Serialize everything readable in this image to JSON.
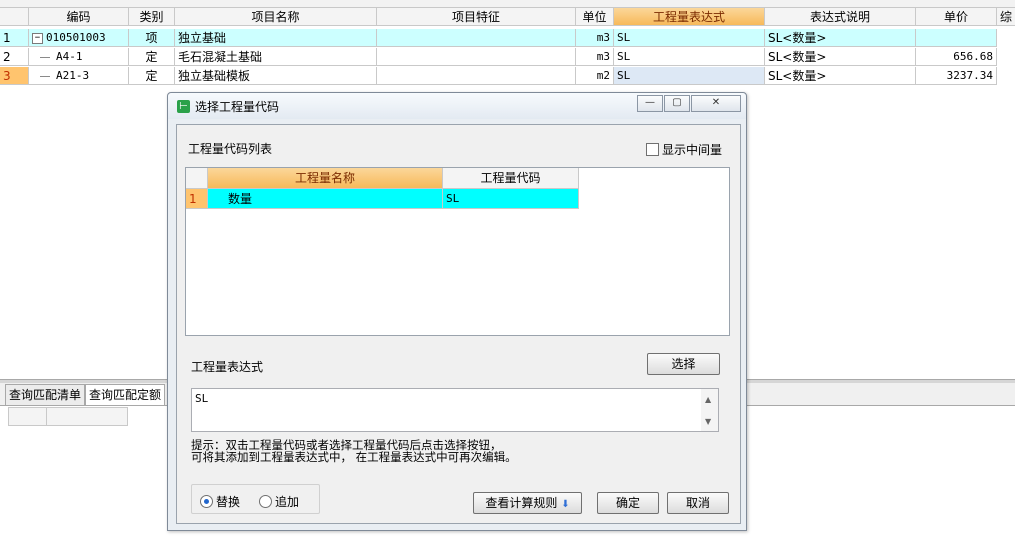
{
  "main_grid": {
    "columns": [
      "",
      "编码",
      "类别",
      "项目名称",
      "项目特征",
      "单位",
      "工程量表达式",
      "表达式说明",
      "单价",
      "综"
    ],
    "rows": [
      {
        "num": "1",
        "expander": "−",
        "code": "010501003",
        "type": "项",
        "name": "独立基础",
        "feature": "",
        "unit": "m3",
        "expr": "SL",
        "desc": "SL<数量>",
        "price": ""
      },
      {
        "num": "2",
        "code": "A4-1",
        "type": "定",
        "name": "毛石混凝土基础",
        "feature": "",
        "unit": "m3",
        "expr": "SL",
        "desc": "SL<数量>",
        "price": "656.68"
      },
      {
        "num": "3",
        "code": "A21-3",
        "type": "定",
        "name": "独立基础模板",
        "feature": "",
        "unit": "m2",
        "expr": "SL",
        "desc": "SL<数量>",
        "price": "3237.34"
      }
    ]
  },
  "bottom_tabs": [
    "查询匹配清单",
    "查询匹配定额"
  ],
  "dialog": {
    "title": "选择工程量代码",
    "code_list_label": "工程量代码列表",
    "show_intermediate_label": "显示中间量",
    "code_grid": {
      "columns": [
        "工程量名称",
        "工程量代码"
      ],
      "rows": [
        {
          "num": "1",
          "name": "数量",
          "code": "SL"
        }
      ]
    },
    "expr_label": "工程量表达式",
    "select_button": "选择",
    "expr_value": "SL",
    "hint_line1": "提示：双击工程量代码或者选择工程量代码后点击选择按钮，",
    "hint_line2": "可将其添加到工程量表达式中， 在工程量表达式中可再次编辑。",
    "radio_replace": "替换",
    "radio_append": "追加",
    "view_rules_button": "查看计算规则",
    "ok_button": "确定",
    "cancel_button": "取消"
  },
  "colors": {
    "selected_header": "#f7b95a",
    "row_highlight": "#ccffff",
    "code_row_highlight": "#00ffff"
  }
}
